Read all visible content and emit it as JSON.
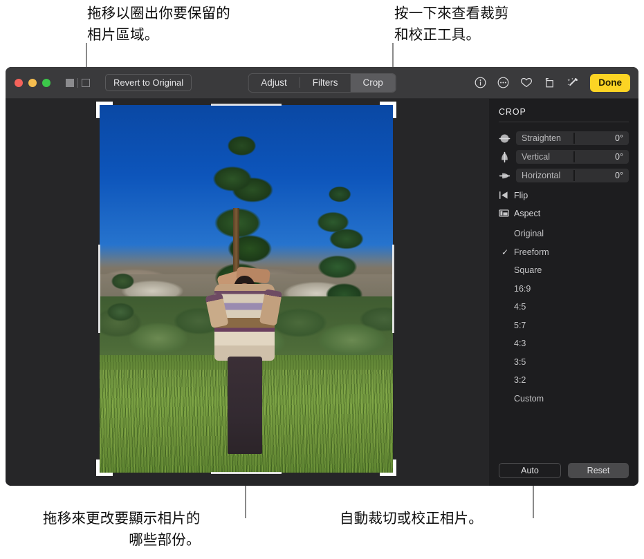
{
  "callouts": {
    "top_left": "拖移以圈出你要保留的\n相片區域。",
    "top_right": "按一下來查看裁剪\n和校正工具。",
    "bottom_left": "拖移來更改要顯示相片的\n哪些部份。",
    "bottom_right": "自動裁切或校正相片。"
  },
  "titlebar": {
    "revert_label": "Revert to Original",
    "segments": [
      {
        "label": "Adjust",
        "active": false
      },
      {
        "label": "Filters",
        "active": false
      },
      {
        "label": "Crop",
        "active": true
      }
    ],
    "icons": [
      "info-icon",
      "more-icon",
      "favorite-heart-icon",
      "rotate-icon",
      "magic-wand-icon"
    ],
    "done_label": "Done",
    "traffic_lights": [
      "close",
      "minimize",
      "zoom"
    ],
    "view_toggle": [
      "single-view",
      "split-view"
    ]
  },
  "sidebar": {
    "section_title": "CROP",
    "sliders": [
      {
        "icon": "straighten-icon",
        "label": "Straighten",
        "value": "0°"
      },
      {
        "icon": "vertical-icon",
        "label": "Vertical",
        "value": "0°"
      },
      {
        "icon": "horizontal-icon",
        "label": "Horizontal",
        "value": "0°"
      }
    ],
    "flip": {
      "icon": "flip-icon",
      "label": "Flip"
    },
    "aspect": {
      "icon": "aspect-icon",
      "label": "Aspect"
    },
    "aspect_options": [
      {
        "label": "Original",
        "selected": false
      },
      {
        "label": "Freeform",
        "selected": true
      },
      {
        "label": "Square",
        "selected": false
      },
      {
        "label": "16:9",
        "selected": false
      },
      {
        "label": "4:5",
        "selected": false
      },
      {
        "label": "5:7",
        "selected": false
      },
      {
        "label": "4:3",
        "selected": false
      },
      {
        "label": "3:5",
        "selected": false
      },
      {
        "label": "3:2",
        "selected": false
      },
      {
        "label": "Custom",
        "selected": false
      }
    ],
    "selected_mark": "✓",
    "auto_label": "Auto",
    "reset_label": "Reset"
  },
  "colors": {
    "accent_done": "#fcd424",
    "window_bg": "#1d1d1f",
    "titlebar_bg": "#3a3a3c",
    "canvas_bg": "#262628",
    "crop_handle": "#ffffff"
  }
}
